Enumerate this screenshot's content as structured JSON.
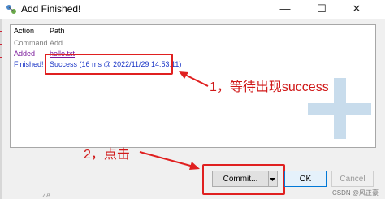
{
  "window": {
    "title": "Add Finished!",
    "minimize": "—",
    "maximize": "☐",
    "close": "✕"
  },
  "table": {
    "headers": [
      "Action",
      "Path"
    ],
    "rows": [
      {
        "action": "Command",
        "path": "Add",
        "style": "gray"
      },
      {
        "action": "Added",
        "path": "hello.txt",
        "style": "purple"
      },
      {
        "action": "Finished!",
        "path": "Success (16 ms @ 2022/11/29 14:53:11)",
        "style": "blue"
      }
    ]
  },
  "annotations": {
    "step1": "1，等待出现success",
    "step2": "2，点击"
  },
  "buttons": {
    "commit": "Commit...",
    "ok": "OK",
    "cancel": "Cancel"
  },
  "watermark": "CSDN @风正豪",
  "stray_text": "ZA.........",
  "colors": {
    "annotation_red": "#e02020",
    "success_blue": "#1a35c6",
    "added_purple": "#7a1a9b"
  }
}
